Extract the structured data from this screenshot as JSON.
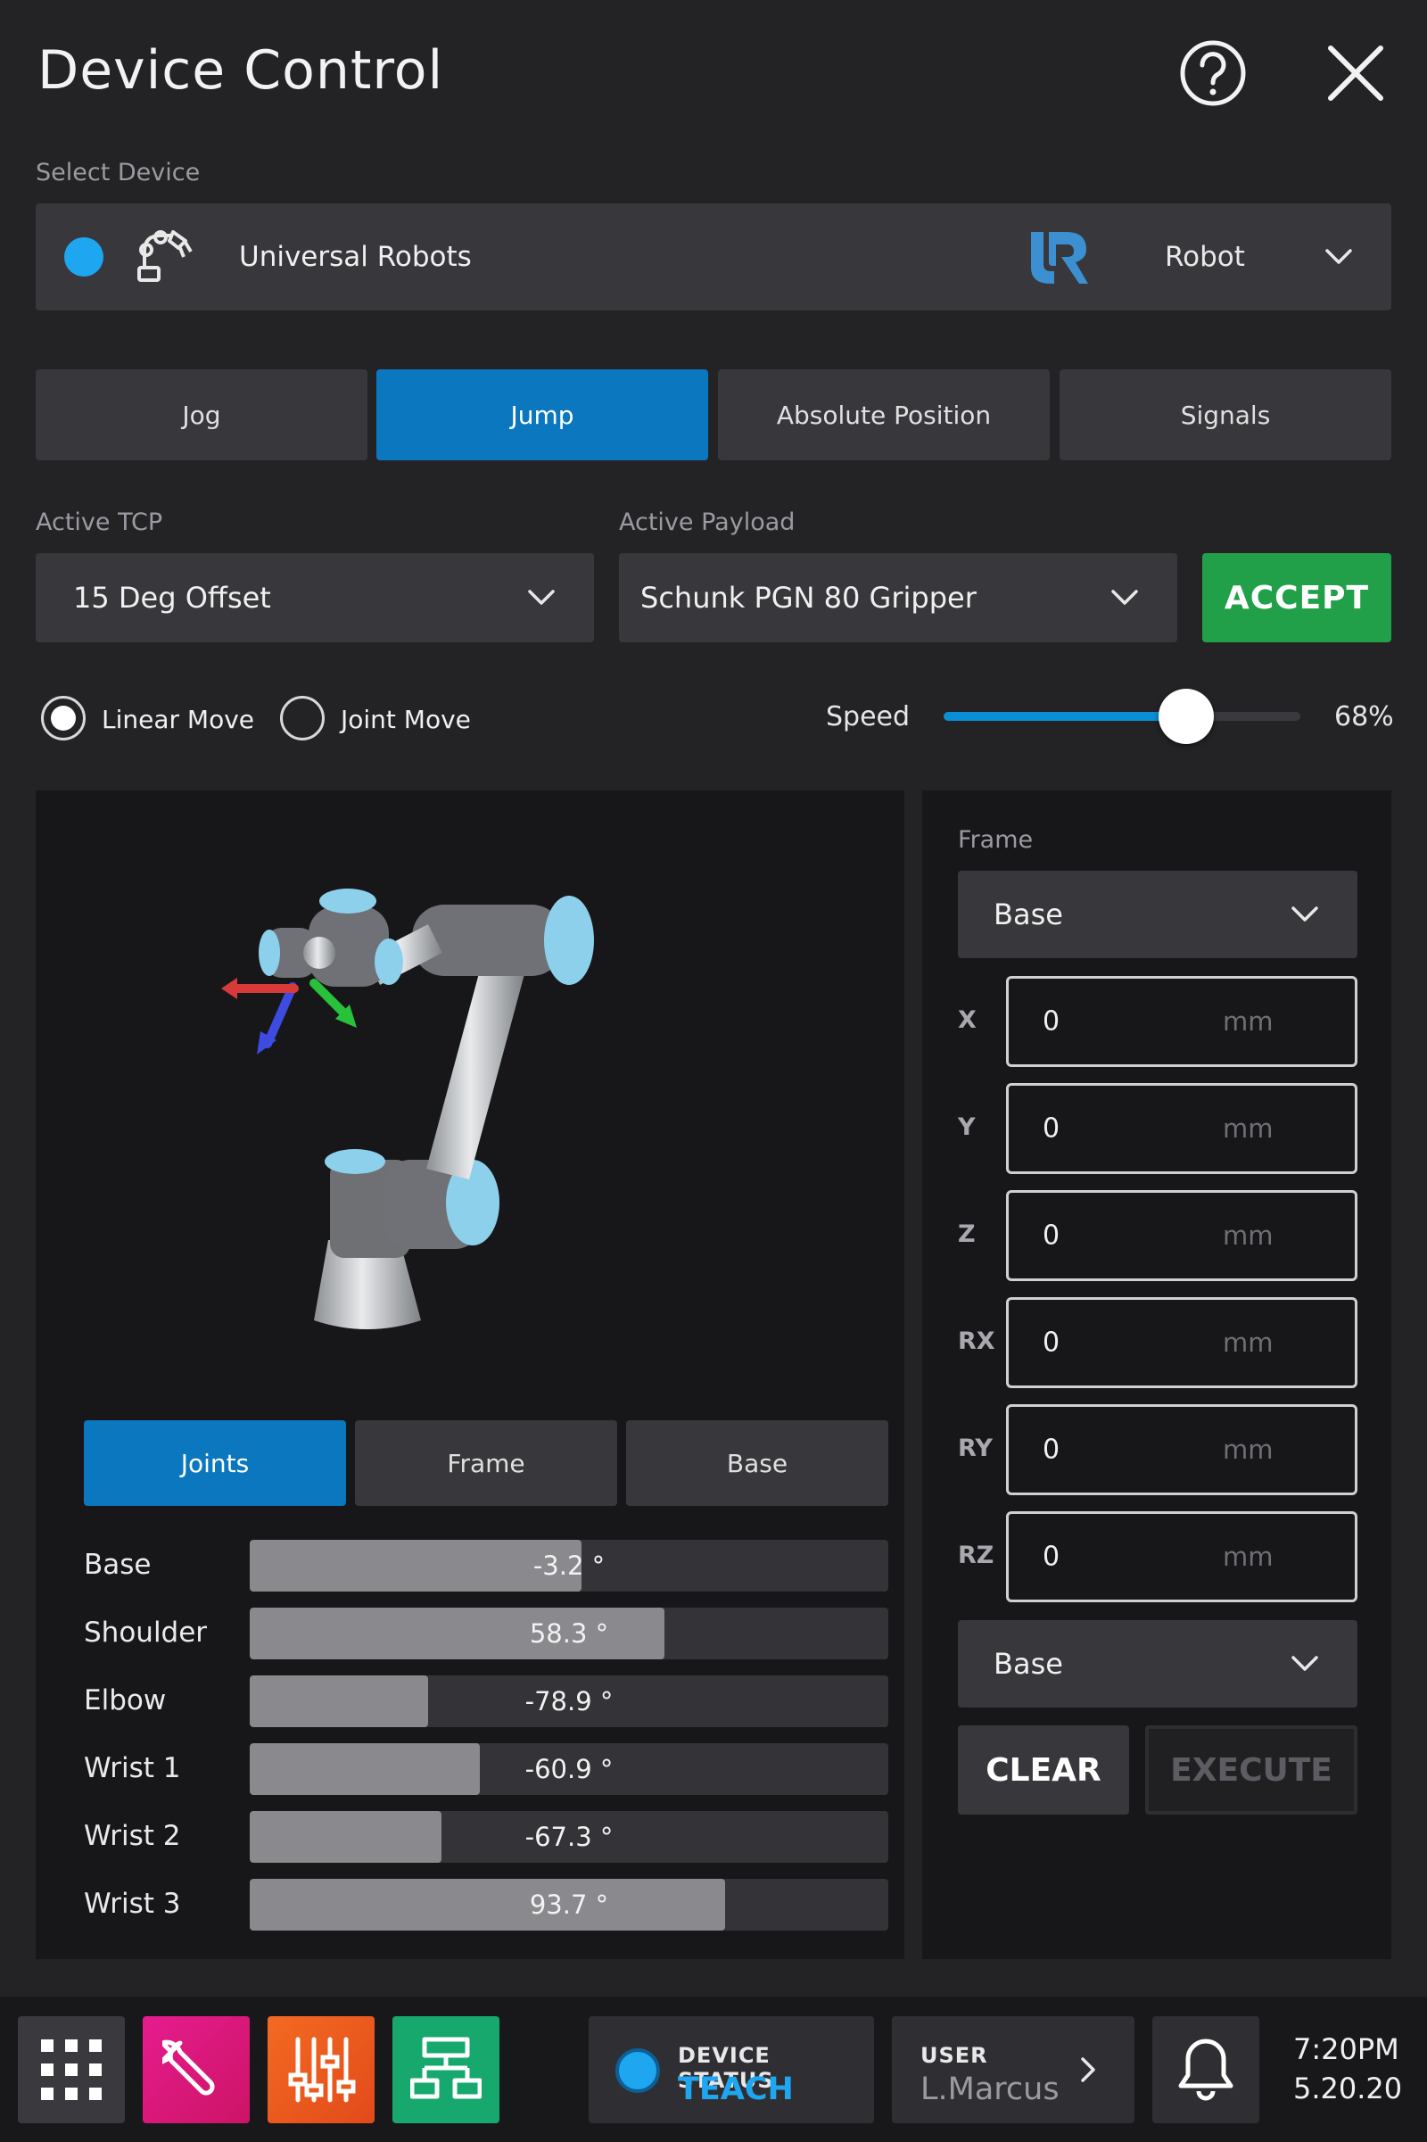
{
  "header": {
    "title": "Device Control",
    "help_icon": "help-circle-icon",
    "close_icon": "close-icon"
  },
  "device": {
    "section_label": "Select Device",
    "status_color": "#1ea7f0",
    "name": "Universal Robots",
    "robot_icon": "robot-arm-icon",
    "brand_icon": "ur-logo-icon",
    "type": "Robot"
  },
  "tabs": [
    {
      "label": "Jog",
      "active": false
    },
    {
      "label": "Jump",
      "active": true
    },
    {
      "label": "Absolute Position",
      "active": false
    },
    {
      "label": "Signals",
      "active": false
    }
  ],
  "tcp": {
    "label": "Active TCP",
    "value": "15 Deg Offset"
  },
  "payload": {
    "label": "Active Payload",
    "value": "Schunk PGN 80 Gripper"
  },
  "accept_label": "ACCEPT",
  "move": {
    "linear_label": "Linear Move",
    "joint_label": "Joint Move",
    "selected": "linear"
  },
  "speed": {
    "label": "Speed",
    "value_text": "68%",
    "value": 68
  },
  "view_tabs": [
    {
      "label": "Joints",
      "active": true
    },
    {
      "label": "Frame",
      "active": false
    },
    {
      "label": "Base",
      "active": false
    }
  ],
  "joints": [
    {
      "name": "Base",
      "value_text": "-3.2 °",
      "fill": 0.52
    },
    {
      "name": "Shoulder",
      "value_text": "58.3 °",
      "fill": 0.65
    },
    {
      "name": "Elbow",
      "value_text": "-78.9 °",
      "fill": 0.28
    },
    {
      "name": "Wrist 1",
      "value_text": "-60.9 °",
      "fill": 0.36
    },
    {
      "name": "Wrist 2",
      "value_text": "-67.3 °",
      "fill": 0.3
    },
    {
      "name": "Wrist 3",
      "value_text": "93.7 °",
      "fill": 0.745
    }
  ],
  "frame": {
    "label": "Frame",
    "value": "Base",
    "coords": [
      {
        "axis": "X",
        "value": "0",
        "unit": "mm"
      },
      {
        "axis": "Y",
        "value": "0",
        "unit": "mm"
      },
      {
        "axis": "Z",
        "value": "0",
        "unit": "mm"
      },
      {
        "axis": "RX",
        "value": "0",
        "unit": "mm"
      },
      {
        "axis": "RY",
        "value": "0",
        "unit": "mm"
      },
      {
        "axis": "RZ",
        "value": "0",
        "unit": "mm"
      }
    ],
    "ref_value": "Base",
    "clear_label": "CLEAR",
    "execute_label": "EXECUTE"
  },
  "bottom_bar": {
    "apps": [
      {
        "icon": "grid-icon",
        "color": "#3a3a3e"
      },
      {
        "icon": "wrench-icon",
        "color": "#d6197a"
      },
      {
        "icon": "sliders-icon",
        "color": "#ee5a1e"
      },
      {
        "icon": "network-icon",
        "color": "#14a56a"
      }
    ],
    "device_status": {
      "label": "DEVICE STATUS",
      "value": "TEACH",
      "color": "#1ea7f0"
    },
    "user": {
      "label": "USER",
      "value": "L.Marcus"
    },
    "bell_icon": "bell-icon",
    "time": "7:20PM",
    "date": "5.20.20"
  }
}
